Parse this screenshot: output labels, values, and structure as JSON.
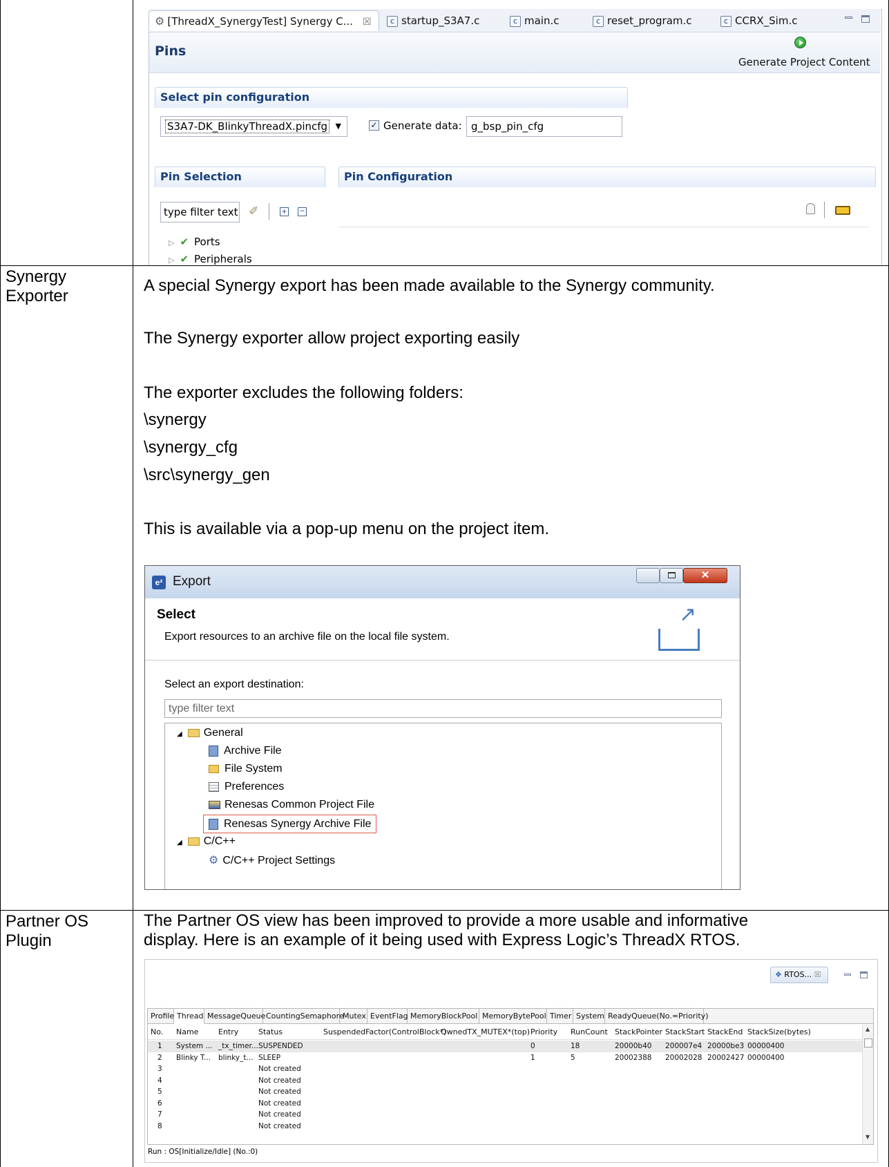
{
  "editor": {
    "tabs": [
      {
        "label": "[ThreadX_SynergyTest] Synergy C...",
        "close": "☒",
        "active": true
      },
      {
        "label": "startup_S3A7.c",
        "icon": "c-file-icon"
      },
      {
        "label": "main.c",
        "icon": "c-file-icon"
      },
      {
        "label": "reset_program.c",
        "icon": "c-file-icon"
      },
      {
        "label": "CCRX_Sim.c",
        "icon": "c-file-icon"
      }
    ],
    "page_title": "Pins",
    "generate_label": "Generate Project Content",
    "select_pin_config_title": "Select pin configuration",
    "pincfg_value": "S3A7-DK_BlinkyThreadX.pincfg",
    "generate_data_label": "Generate data:",
    "generate_data_checked": true,
    "generate_data_value": "g_bsp_pin_cfg",
    "pin_selection_title": "Pin Selection",
    "pin_configuration_title": "Pin Configuration",
    "filter_placeholder": "type filter text",
    "tree": [
      {
        "label": "Ports"
      },
      {
        "label": "Peripherals"
      }
    ]
  },
  "rows": [
    {
      "label": "Synergy Exporter",
      "paragraphs": [
        "A special Synergy export has been made available to the Synergy community.",
        "The Synergy exporter allow project exporting easily",
        "The exporter excludes the following folders:",
        "\\synergy",
        "\\synergy_cfg",
        "\\src\\synergy_gen",
        "This is available via a pop-up menu on the project item."
      ]
    },
    {
      "label": "Partner OS Plugin",
      "paragraphs": [
        "The Partner OS view has been improved to provide a more usable and informative",
        "display. Here is an example of it being used with Express Logic’s ThreadX RTOS."
      ]
    }
  ],
  "export_dialog": {
    "title": "Export",
    "heading": "Select",
    "description": "Export resources to an archive file on the local file system.",
    "destination_label": "Select an export destination:",
    "filter_placeholder": "type filter text",
    "tree": [
      {
        "label": "General",
        "level": 0,
        "icon": "folder-open-icon"
      },
      {
        "label": "Archive File",
        "level": 1,
        "icon": "archive-icon"
      },
      {
        "label": "File System",
        "level": 1,
        "icon": "folder-icon"
      },
      {
        "label": "Preferences",
        "level": 1,
        "icon": "preferences-icon"
      },
      {
        "label": "Renesas Common Project File",
        "level": 1,
        "icon": "folder-open-icon"
      },
      {
        "label": "Renesas Synergy Archive File",
        "level": 1,
        "icon": "archive-icon",
        "highlighted": true
      },
      {
        "label": "C/C++",
        "level": 0,
        "icon": "folder-open-icon"
      },
      {
        "label": "C/C++ Project Settings",
        "level": 1,
        "icon": "settings-icon"
      }
    ]
  },
  "rtos_view": {
    "view_tab": "RTOS...",
    "tabs": [
      "Profile",
      "Thread",
      "MessageQueue",
      "CountingSemaphore",
      "Mutex",
      "EventFlag",
      "MemoryBlockPool",
      "MemoryBytePool",
      "Timer",
      "System",
      "ReadyQueue(No.=Priority)"
    ],
    "active_tab": "Thread",
    "columns": [
      "No.",
      "Name",
      "Entry",
      "Status",
      "SuspendedFactor(ControlBlock*)",
      "OwnedTX_MUTEX*(top)",
      "Priority",
      "RunCount",
      "StackPointer",
      "StackStart",
      "StackEnd",
      "StackSize(bytes)"
    ],
    "rows": [
      [
        "1",
        "System ...",
        "_tx_timer...",
        "SUSPENDED",
        "",
        "",
        "0",
        "18",
        "20000b40",
        "200007e4",
        "20000be3",
        "00000400"
      ],
      [
        "2",
        "Blinky T...",
        "blinky_t...",
        "SLEEP",
        "",
        "",
        "1",
        "5",
        "20002388",
        "20002028",
        "20002427",
        "00000400"
      ],
      [
        "3",
        "",
        "",
        "Not created",
        "",
        "",
        "",
        "",
        "",
        "",
        "",
        ""
      ],
      [
        "4",
        "",
        "",
        "Not created",
        "",
        "",
        "",
        "",
        "",
        "",
        "",
        ""
      ],
      [
        "5",
        "",
        "",
        "Not created",
        "",
        "",
        "",
        "",
        "",
        "",
        "",
        ""
      ],
      [
        "6",
        "",
        "",
        "Not created",
        "",
        "",
        "",
        "",
        "",
        "",
        "",
        ""
      ],
      [
        "7",
        "",
        "",
        "Not created",
        "",
        "",
        "",
        "",
        "",
        "",
        "",
        ""
      ],
      [
        "8",
        "",
        "",
        "Not created",
        "",
        "",
        "",
        "",
        "",
        "",
        "",
        ""
      ]
    ],
    "status_text": "Run : OS[Initialize/Idle] (No.:0)"
  }
}
